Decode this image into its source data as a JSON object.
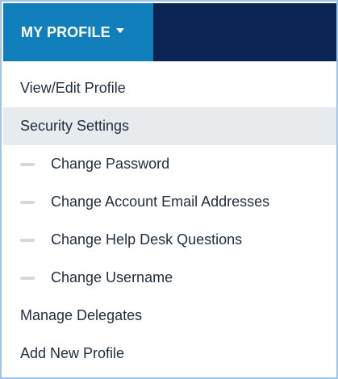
{
  "header": {
    "title": "MY PROFILE",
    "dropdown_icon": "caret-down-icon",
    "colors": {
      "tab_bg": "#127fbd",
      "bar_bg": "#0b2453",
      "text": "#ffffff"
    }
  },
  "menu": {
    "items": [
      {
        "label": "View/Edit Profile"
      },
      {
        "label": "Security Settings",
        "active": true
      },
      {
        "label": "Change Password",
        "sub": true
      },
      {
        "label": "Change Account Email Addresses",
        "sub": true
      },
      {
        "label": "Change Help Desk Questions",
        "sub": true
      },
      {
        "label": "Change Username",
        "sub": true
      },
      {
        "label": "Manage Delegates"
      },
      {
        "label": "Add New Profile"
      }
    ],
    "colors": {
      "active_bg": "#e7ebee",
      "text": "#1f2d3d",
      "dash": "#d3d8dc"
    }
  }
}
